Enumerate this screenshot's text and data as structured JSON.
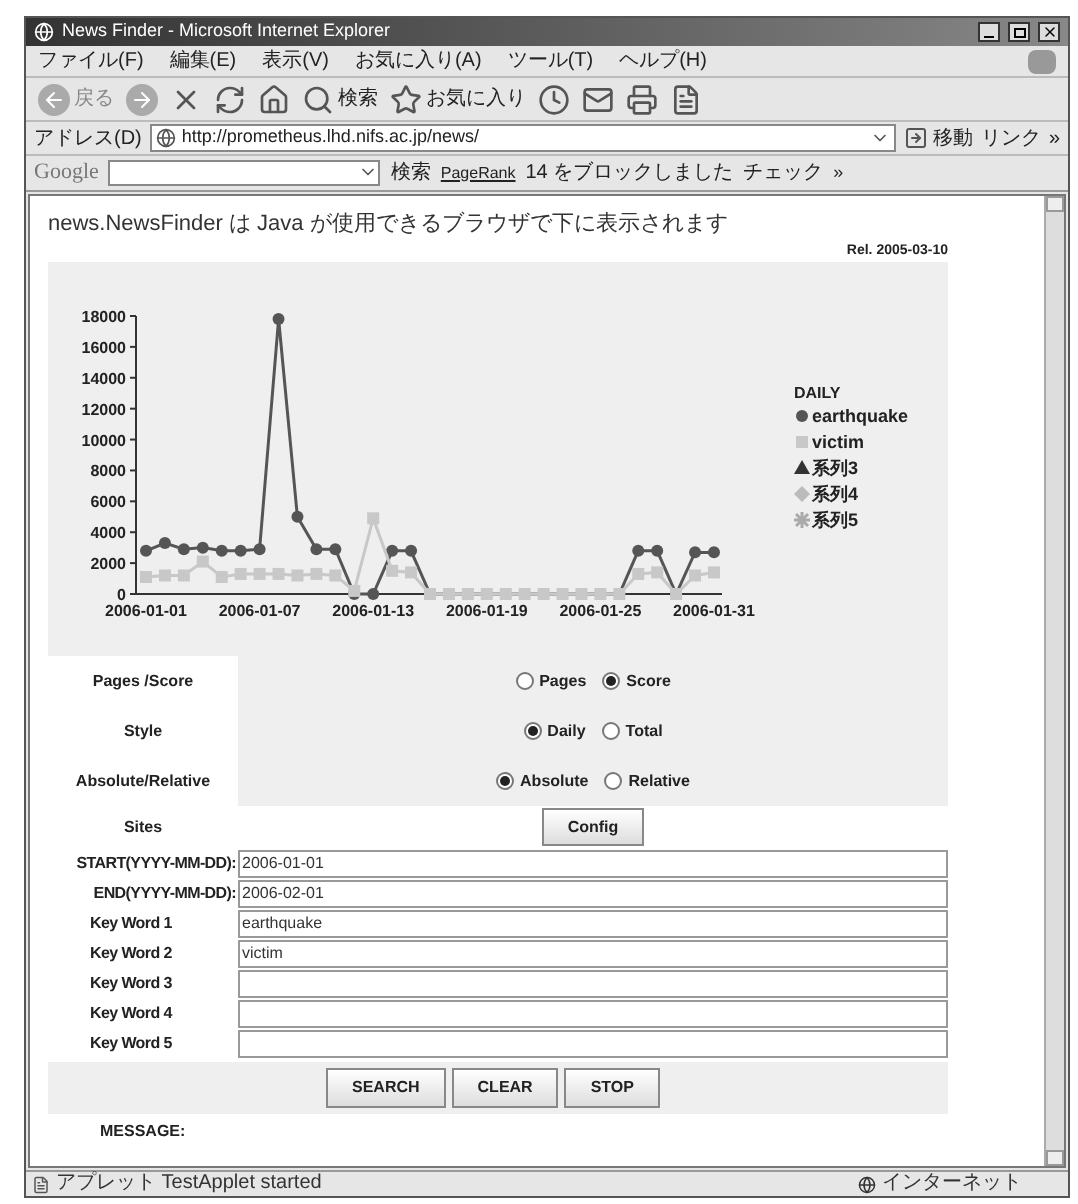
{
  "window": {
    "title": "News Finder - Microsoft Internet Explorer"
  },
  "menu": [
    "ファイル(F)",
    "編集(E)",
    "表示(V)",
    "お気に入り(A)",
    "ツール(T)",
    "ヘルプ(H)"
  ],
  "toolbar": {
    "back": "戻る",
    "search": "検索",
    "favorites": "お気に入り"
  },
  "address_bar": {
    "label": "アドレス(D)",
    "url": "http://prometheus.lhd.nifs.ac.jp/news/",
    "go": "移動",
    "links": "リンク",
    "more": "»"
  },
  "google_bar": {
    "logo": "Google",
    "search": "検索",
    "pagerank": "PageRank",
    "blocked": "14 をブロックしました",
    "check": "チェック",
    "more": "»"
  },
  "page": {
    "notice": "news.NewsFinder は Java が使用できるブラウザで下に表示されます",
    "release": "Rel. 2005-03-10"
  },
  "chart": {
    "chart_data": {
      "type": "line",
      "legend": {
        "title": "DAILY"
      },
      "categories": [
        "2006-01-01",
        null,
        null,
        null,
        null,
        null,
        "2006-01-07",
        null,
        null,
        null,
        null,
        null,
        "2006-01-13",
        null,
        null,
        null,
        null,
        null,
        "2006-01-19",
        null,
        null,
        null,
        null,
        null,
        "2006-01-25",
        null,
        null,
        null,
        null,
        null,
        "2006-01-31"
      ],
      "ylim": [
        0,
        18000
      ],
      "yticks": [
        0,
        2000,
        4000,
        6000,
        8000,
        10000,
        12000,
        14000,
        16000,
        18000
      ],
      "series": [
        {
          "name": "earthquake",
          "marker": "circle",
          "color": "#555555",
          "values": [
            2800,
            3300,
            2900,
            3000,
            2800,
            2800,
            2900,
            17800,
            5000,
            2900,
            2900,
            0,
            0,
            2800,
            2800,
            0,
            0,
            0,
            0,
            0,
            0,
            0,
            0,
            0,
            0,
            0,
            2800,
            2800,
            0,
            2700,
            2700
          ]
        },
        {
          "name": "victim",
          "marker": "square",
          "color": "#c8c8c8",
          "values": [
            1100,
            1200,
            1200,
            2100,
            1100,
            1300,
            1300,
            1300,
            1200,
            1300,
            1200,
            200,
            4900,
            1500,
            1400,
            0,
            0,
            0,
            0,
            0,
            0,
            0,
            0,
            0,
            0,
            0,
            1300,
            1400,
            0,
            1200,
            1400
          ]
        },
        {
          "name": "系列3",
          "marker": "triangle",
          "color": "#333333",
          "values": [
            null,
            null,
            null,
            null,
            null,
            null,
            null,
            null,
            null,
            null,
            null,
            null,
            null,
            null,
            null,
            null,
            null,
            null,
            null,
            null,
            null,
            null,
            null,
            null,
            null,
            null,
            null,
            null,
            null,
            null,
            null
          ]
        },
        {
          "name": "系列4",
          "marker": "diamond",
          "color": "#bbbbbb",
          "values": [
            null,
            null,
            null,
            null,
            null,
            null,
            null,
            null,
            null,
            null,
            null,
            null,
            null,
            null,
            null,
            null,
            null,
            null,
            null,
            null,
            null,
            null,
            null,
            null,
            null,
            null,
            null,
            null,
            null,
            null,
            null
          ]
        },
        {
          "name": "系列5",
          "marker": "asterisk",
          "color": "#aaaaaa",
          "values": [
            null,
            null,
            null,
            null,
            null,
            null,
            null,
            null,
            null,
            null,
            null,
            null,
            null,
            null,
            null,
            null,
            null,
            null,
            null,
            null,
            null,
            null,
            null,
            null,
            null,
            null,
            null,
            null,
            null,
            null,
            null
          ]
        }
      ]
    }
  },
  "options": [
    {
      "label": "Pages /Score",
      "choices": [
        {
          "label": "Pages",
          "selected": false
        },
        {
          "label": "Score",
          "selected": true
        }
      ]
    },
    {
      "label": "Style",
      "choices": [
        {
          "label": "Daily",
          "selected": true
        },
        {
          "label": "Total",
          "selected": false
        }
      ]
    },
    {
      "label": "Absolute/Relative",
      "choices": [
        {
          "label": "Absolute",
          "selected": true
        },
        {
          "label": "Relative",
          "selected": false
        }
      ]
    }
  ],
  "sites": {
    "label": "Sites",
    "button": "Config"
  },
  "fields": [
    {
      "label": "START(YYYY-MM-DD):",
      "value": "2006-01-01"
    },
    {
      "label": "END(YYYY-MM-DD):",
      "value": "2006-02-01"
    },
    {
      "label": "Key Word 1",
      "value": "earthquake"
    },
    {
      "label": "Key Word 2",
      "value": "victim"
    },
    {
      "label": "Key Word 3"
    },
    {
      "label": "Key Word 4"
    },
    {
      "label": "Key Word 5"
    }
  ],
  "buttons": [
    "SEARCH",
    "CLEAR",
    "STOP"
  ],
  "message": {
    "label": "MESSAGE:"
  },
  "status_bar": {
    "text": "アプレット TestApplet started",
    "zone": "インターネット"
  }
}
